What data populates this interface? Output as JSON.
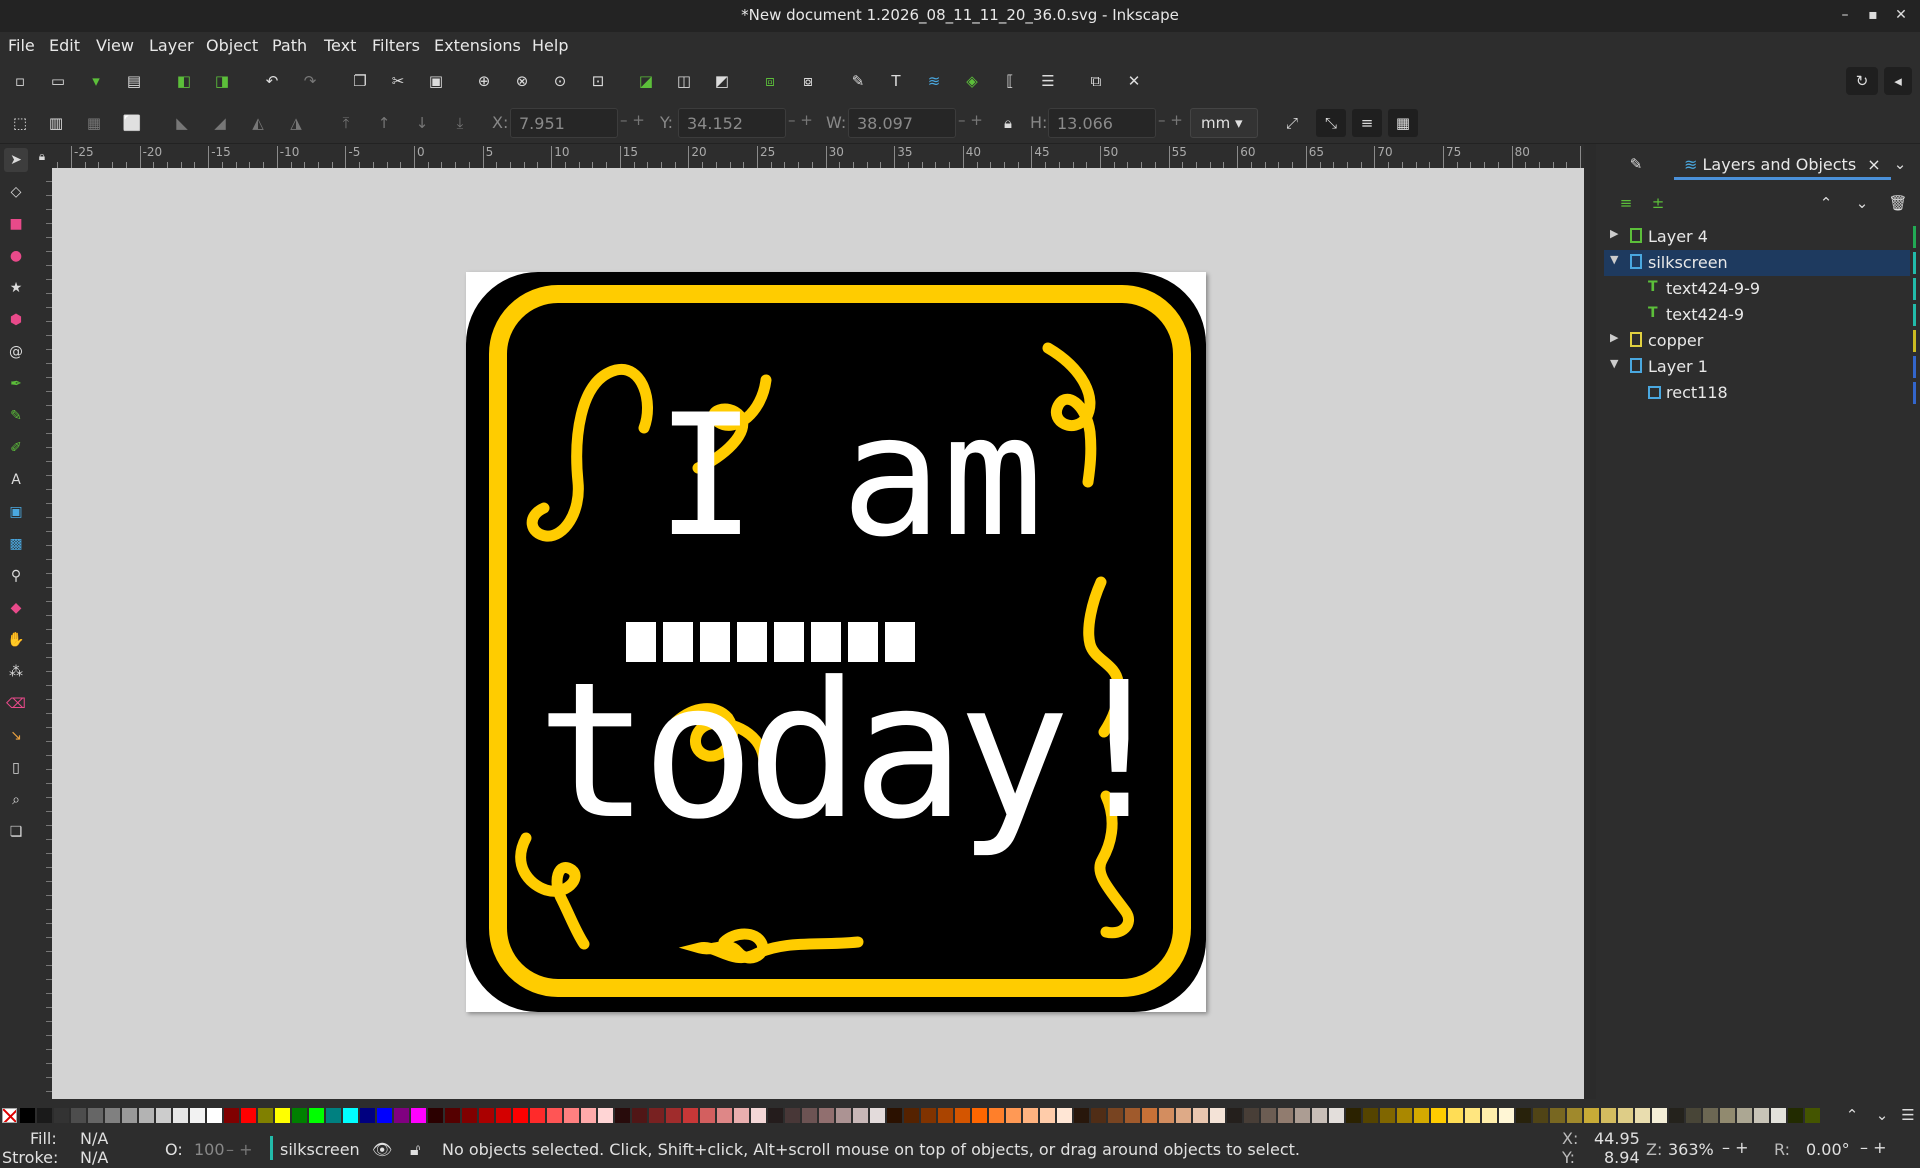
{
  "window": {
    "title": "*New document 1.2026_08_11_11_20_36.0.svg - Inkscape",
    "controls": [
      "–",
      "▪",
      "✕"
    ]
  },
  "menu": [
    "File",
    "Edit",
    "View",
    "Layer",
    "Object",
    "Path",
    "Text",
    "Filters",
    "Extensions",
    "Help"
  ],
  "toolbar_icons": [
    "new-icon",
    "open-icon",
    "save-icon",
    "print-icon",
    "import-icon",
    "export-icon",
    "undo-icon",
    "redo-icon",
    "copy-icon",
    "cut-icon",
    "paste-icon",
    "zoom-selection-icon",
    "zoom-drawing-icon",
    "zoom-page-icon",
    "zoom-center-icon",
    "duplicate-icon",
    "clone-icon",
    "unlink-clone-icon",
    "group-icon",
    "ungroup-icon",
    "xml-editor-icon",
    "text-font-icon",
    "layers-icon",
    "symbols-icon",
    "objects-icon",
    "align-icon",
    "document-properties-icon",
    "preferences-icon"
  ],
  "controls": {
    "x_label": "X:",
    "x_value": "7.951",
    "y_label": "Y:",
    "y_value": "34.152",
    "w_label": "W:",
    "w_value": "38.097",
    "h_label": "H:",
    "h_value": "13.066",
    "unit": "mm",
    "spin": "– +"
  },
  "ruler": {
    "labels": [
      "-25",
      "-20",
      "-15",
      "-10",
      "-5",
      "0",
      "5",
      "10",
      "15",
      "20",
      "25",
      "30",
      "35",
      "40",
      "45",
      "50",
      "55",
      "60",
      "65",
      "70",
      "75",
      "80"
    ]
  },
  "artwork": {
    "line1_a": "I",
    "line1_b": "am",
    "line3": "today!",
    "blank_count": 8,
    "colors": {
      "outer": "#000000",
      "ring": "#ffcc00",
      "text": "#ffffff",
      "squiggle": "#ffcc00"
    }
  },
  "panel": {
    "tab_label": "Layers and Objects",
    "tab_close": "×",
    "rows": [
      {
        "name": "Layer 4",
        "indent": 0,
        "expanded": false,
        "kind": "layer",
        "icon_color": "#5cbf3a",
        "stripe": "#22aa55",
        "selected": false
      },
      {
        "name": "silkscreen",
        "indent": 0,
        "expanded": true,
        "kind": "layer",
        "icon_color": "#4aa8e0",
        "stripe": "#22bbaa",
        "selected": true
      },
      {
        "name": "text424-9-9",
        "indent": 1,
        "expanded": null,
        "kind": "text",
        "icon_color": "#5cbf3a",
        "stripe": "#22bbaa",
        "selected": false
      },
      {
        "name": "text424-9",
        "indent": 1,
        "expanded": null,
        "kind": "text",
        "icon_color": "#5cbf3a",
        "stripe": "#22bbaa",
        "selected": false
      },
      {
        "name": "copper",
        "indent": 0,
        "expanded": false,
        "kind": "layer",
        "icon_color": "#e0d040",
        "stripe": "#ccbb22",
        "selected": false
      },
      {
        "name": "Layer 1",
        "indent": 0,
        "expanded": true,
        "kind": "layer",
        "icon_color": "#4aa8e0",
        "stripe": "#3366cc",
        "selected": false
      },
      {
        "name": "rect118",
        "indent": 1,
        "expanded": null,
        "kind": "rect",
        "icon_color": "#4aa8e0",
        "stripe": "#3366cc",
        "selected": false
      }
    ]
  },
  "palette": [
    "#000000",
    "#1a1a1a",
    "#333333",
    "#4d4d4d",
    "#666666",
    "#808080",
    "#999999",
    "#b3b3b3",
    "#cccccc",
    "#e6e6e6",
    "#f2f2f2",
    "#ffffff",
    "#800000",
    "#ff0000",
    "#808000",
    "#ffff00",
    "#008000",
    "#00ff00",
    "#008080",
    "#00ffff",
    "#000080",
    "#0000ff",
    "#800080",
    "#ff00ff",
    "#2b0000",
    "#550000",
    "#800000",
    "#aa0000",
    "#d40000",
    "#ff0000",
    "#ff2a2a",
    "#ff5555",
    "#ff8080",
    "#ffaaaa",
    "#ffd5d5",
    "#280b0b",
    "#501616",
    "#782121",
    "#a02c2c",
    "#c83737",
    "#d35f5f",
    "#de8787",
    "#e9afaf",
    "#f4d7d7",
    "#241c1c",
    "#483737",
    "#6c5353",
    "#916f6f",
    "#ac9393",
    "#c8b7b7",
    "#e3dbdb",
    "#2b1100",
    "#552200",
    "#803300",
    "#aa4400",
    "#d45500",
    "#ff6600",
    "#ff7f2a",
    "#ff9955",
    "#ffb380",
    "#ffccaa",
    "#ffe6d5",
    "#28170b",
    "#502d16",
    "#784421",
    "#a05a2c",
    "#c87137",
    "#d38d5f",
    "#deaa87",
    "#e9c6af",
    "#f4e3d7",
    "#241f1c",
    "#483e37",
    "#6c5d53",
    "#917c6f",
    "#ac9d93",
    "#c8beb7",
    "#e3dedb",
    "#2b2200",
    "#554400",
    "#806600",
    "#aa8800",
    "#d4aa00",
    "#ffcc00",
    "#ffdd55",
    "#ffe680",
    "#ffeeaa",
    "#fff6d5",
    "#28220b",
    "#504416",
    "#786721",
    "#a0892c",
    "#c8ab37",
    "#d3bc5f",
    "#decd87",
    "#e9ddaf",
    "#f4eed7",
    "#24221c",
    "#484537",
    "#6c6753",
    "#918a6f",
    "#aca793",
    "#c8c4b7",
    "#e3e2db",
    "#222b00",
    "#445500"
  ],
  "status": {
    "fill_label": "Fill:",
    "fill_value": "N/A",
    "stroke_label": "Stroke:",
    "stroke_value": "N/A",
    "opacity_label": "O:",
    "opacity_value": "100",
    "layer_name": "silkscreen",
    "message": "No objects selected. Click, Shift+click, Alt+scroll mouse on top of objects, or drag around objects to select.",
    "x_label": "X:",
    "x_value": "44.95",
    "y_label": "Y:",
    "y_value": "8.94",
    "zoom_label": "Z:",
    "zoom_value": "363%",
    "rot_label": "R:",
    "rot_value": "0.00°"
  }
}
